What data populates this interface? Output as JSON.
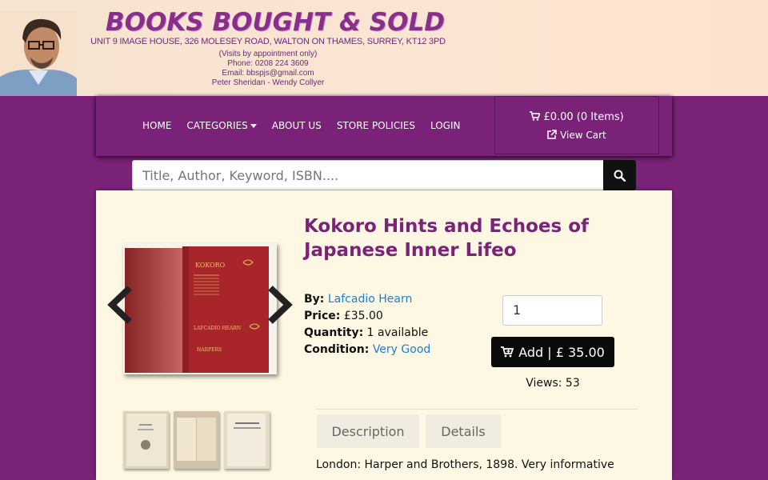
{
  "banner": {
    "title": "BOOKS BOUGHT & SOLD",
    "address": "UNIT 9 IMAGE HOUSE, 326 MOLESEY ROAD, WALTON ON THAMES, SURREY, KT12 3PD",
    "visits": "(Visits by appointment only)",
    "phone": "Phone: 0208 224 3609",
    "email": "Email: bbspjs@gmail.com",
    "names": "Peter Sheridan - Wendy Collyer"
  },
  "nav": {
    "items": [
      {
        "label": "HOME"
      },
      {
        "label": "CATEGORIES"
      },
      {
        "label": "ABOUT US"
      },
      {
        "label": "STORE POLICIES"
      },
      {
        "label": "LOGIN"
      }
    ],
    "cart_summary": "£0.00 (0 Items)",
    "view_cart": "View Cart"
  },
  "search": {
    "placeholder": "Title, Author, Keyword, ISBN...."
  },
  "product": {
    "title": "Kokoro Hints and Echoes of Japanese Inner Lifeo",
    "by_label": "By:",
    "author": "Lafcadio Hearn",
    "price_label": "Price:",
    "price": "£35.00",
    "quantity_label": "Quantity:",
    "quantity": "1 available",
    "condition_label": "Condition:",
    "condition": "Very Good",
    "qty_value": "1",
    "add_button": "Add | £ 35.00",
    "views": "Views: 53",
    "spine_title": "KOKORO",
    "spine_author": "LAFCADIO HEARN",
    "spine_publisher": "HARPERS"
  },
  "tabs": [
    {
      "label": "Description"
    },
    {
      "label": "Details"
    }
  ],
  "description": "London: Harper and Brothers, 1898. Very informative",
  "colors": {
    "brand_purple": "#7b2279",
    "banner_bg": "#fbe5d2",
    "panel_bg": "#fdf7e3",
    "link_blue": "#1f7fd1"
  }
}
